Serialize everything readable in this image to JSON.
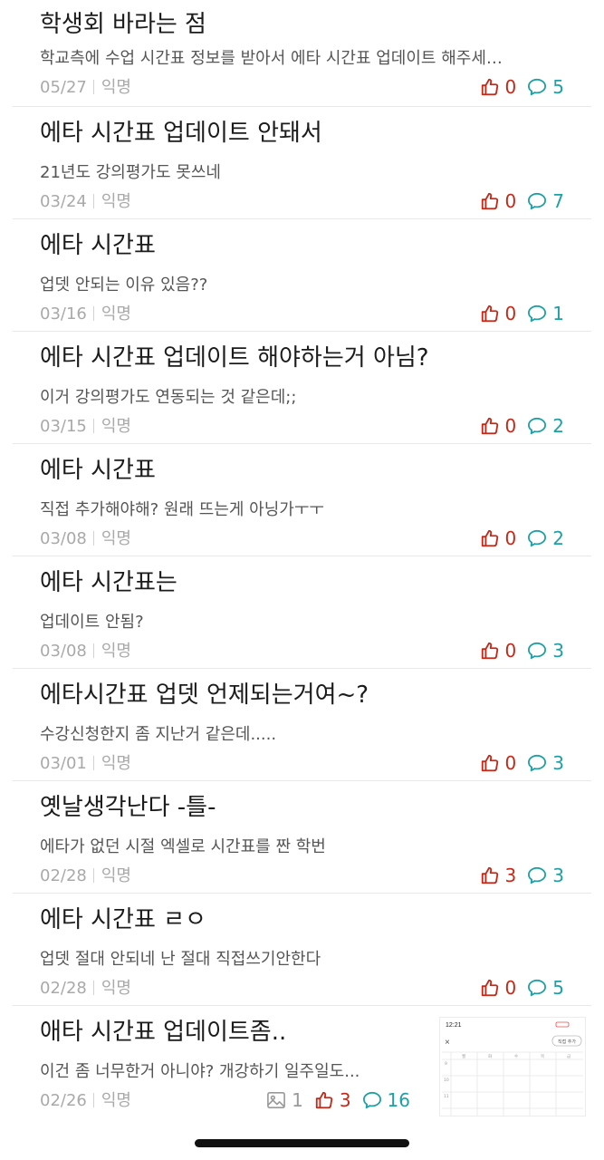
{
  "posts": [
    {
      "title": "학생회 바라는 점",
      "preview": "학교측에 수업 시간표 정보를 받아서 에타 시간표 업데이트 해주세…",
      "date": "05/27",
      "author": "익명",
      "likes": "0",
      "comments": "5"
    },
    {
      "title": "에타 시간표 업데이트 안돼서",
      "preview": "21년도 강의평가도 못쓰네",
      "date": "03/24",
      "author": "익명",
      "likes": "0",
      "comments": "7"
    },
    {
      "title": "에타 시간표",
      "preview": "업뎃 안되는 이유 있음??",
      "date": "03/16",
      "author": "익명",
      "likes": "0",
      "comments": "1"
    },
    {
      "title": "에타 시간표 업데이트 해야하는거 아님?",
      "preview": "이거 강의평가도 연동되는 것 같은데;;",
      "date": "03/15",
      "author": "익명",
      "likes": "0",
      "comments": "2"
    },
    {
      "title": "에타 시간표",
      "preview": "직접 추가해야해? 원래 뜨는게 아닝가ㅜㅜ",
      "date": "03/08",
      "author": "익명",
      "likes": "0",
      "comments": "2"
    },
    {
      "title": "에타 시간표는",
      "preview": "업데이트 안됨?",
      "date": "03/08",
      "author": "익명",
      "likes": "0",
      "comments": "3"
    },
    {
      "title": "에타시간표 업뎃 언제되는거여~?",
      "preview": "수강신청한지 좀 지난거 같은데.....",
      "date": "03/01",
      "author": "익명",
      "likes": "0",
      "comments": "3"
    },
    {
      "title": "옛날생각난다 -틀-",
      "preview": "에타가 없던 시절 엑셀로 시간표를 짠 학번",
      "date": "02/28",
      "author": "익명",
      "likes": "3",
      "comments": "3"
    },
    {
      "title": "에타 시간표 ㄹㅇ",
      "preview": "업뎃 절대 안되네 난 절대 직접쓰기안한다",
      "date": "02/28",
      "author": "익명",
      "likes": "0",
      "comments": "5"
    },
    {
      "title": "애타 시간표 업데이트좀..",
      "preview": "이건 좀 너무한거 아니야? 개강하기 일주일도...",
      "date": "02/26",
      "author": "익명",
      "images": "1",
      "likes": "3",
      "comments": "16"
    }
  ],
  "thumbnail": {
    "time": "12:21",
    "button": "직접 추가",
    "close": "×",
    "days": [
      "월",
      "화",
      "수",
      "목",
      "금"
    ],
    "hours": [
      "9",
      "10",
      "11"
    ]
  },
  "colors": {
    "like": "#c62917",
    "comment": "#1ea0a7",
    "meta": "#a9a9a9"
  },
  "icons": {
    "like": "thumbs-up-icon",
    "comment": "speech-bubble-icon",
    "image": "image-icon"
  }
}
